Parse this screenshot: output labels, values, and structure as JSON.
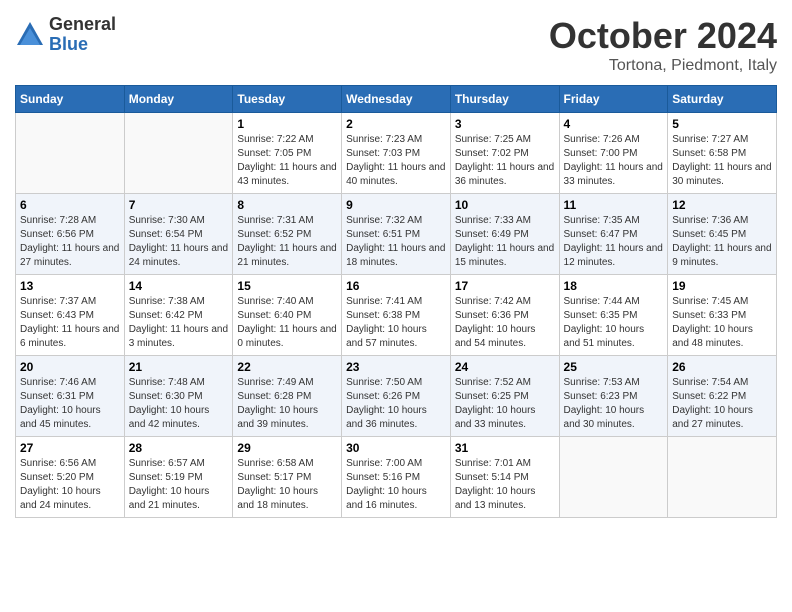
{
  "logo": {
    "general": "General",
    "blue": "Blue"
  },
  "title": {
    "month": "October 2024",
    "location": "Tortona, Piedmont, Italy"
  },
  "weekdays": [
    "Sunday",
    "Monday",
    "Tuesday",
    "Wednesday",
    "Thursday",
    "Friday",
    "Saturday"
  ],
  "weeks": [
    [
      {
        "day": "",
        "info": ""
      },
      {
        "day": "",
        "info": ""
      },
      {
        "day": "1",
        "info": "Sunrise: 7:22 AM\nSunset: 7:05 PM\nDaylight: 11 hours and 43 minutes."
      },
      {
        "day": "2",
        "info": "Sunrise: 7:23 AM\nSunset: 7:03 PM\nDaylight: 11 hours and 40 minutes."
      },
      {
        "day": "3",
        "info": "Sunrise: 7:25 AM\nSunset: 7:02 PM\nDaylight: 11 hours and 36 minutes."
      },
      {
        "day": "4",
        "info": "Sunrise: 7:26 AM\nSunset: 7:00 PM\nDaylight: 11 hours and 33 minutes."
      },
      {
        "day": "5",
        "info": "Sunrise: 7:27 AM\nSunset: 6:58 PM\nDaylight: 11 hours and 30 minutes."
      }
    ],
    [
      {
        "day": "6",
        "info": "Sunrise: 7:28 AM\nSunset: 6:56 PM\nDaylight: 11 hours and 27 minutes."
      },
      {
        "day": "7",
        "info": "Sunrise: 7:30 AM\nSunset: 6:54 PM\nDaylight: 11 hours and 24 minutes."
      },
      {
        "day": "8",
        "info": "Sunrise: 7:31 AM\nSunset: 6:52 PM\nDaylight: 11 hours and 21 minutes."
      },
      {
        "day": "9",
        "info": "Sunrise: 7:32 AM\nSunset: 6:51 PM\nDaylight: 11 hours and 18 minutes."
      },
      {
        "day": "10",
        "info": "Sunrise: 7:33 AM\nSunset: 6:49 PM\nDaylight: 11 hours and 15 minutes."
      },
      {
        "day": "11",
        "info": "Sunrise: 7:35 AM\nSunset: 6:47 PM\nDaylight: 11 hours and 12 minutes."
      },
      {
        "day": "12",
        "info": "Sunrise: 7:36 AM\nSunset: 6:45 PM\nDaylight: 11 hours and 9 minutes."
      }
    ],
    [
      {
        "day": "13",
        "info": "Sunrise: 7:37 AM\nSunset: 6:43 PM\nDaylight: 11 hours and 6 minutes."
      },
      {
        "day": "14",
        "info": "Sunrise: 7:38 AM\nSunset: 6:42 PM\nDaylight: 11 hours and 3 minutes."
      },
      {
        "day": "15",
        "info": "Sunrise: 7:40 AM\nSunset: 6:40 PM\nDaylight: 11 hours and 0 minutes."
      },
      {
        "day": "16",
        "info": "Sunrise: 7:41 AM\nSunset: 6:38 PM\nDaylight: 10 hours and 57 minutes."
      },
      {
        "day": "17",
        "info": "Sunrise: 7:42 AM\nSunset: 6:36 PM\nDaylight: 10 hours and 54 minutes."
      },
      {
        "day": "18",
        "info": "Sunrise: 7:44 AM\nSunset: 6:35 PM\nDaylight: 10 hours and 51 minutes."
      },
      {
        "day": "19",
        "info": "Sunrise: 7:45 AM\nSunset: 6:33 PM\nDaylight: 10 hours and 48 minutes."
      }
    ],
    [
      {
        "day": "20",
        "info": "Sunrise: 7:46 AM\nSunset: 6:31 PM\nDaylight: 10 hours and 45 minutes."
      },
      {
        "day": "21",
        "info": "Sunrise: 7:48 AM\nSunset: 6:30 PM\nDaylight: 10 hours and 42 minutes."
      },
      {
        "day": "22",
        "info": "Sunrise: 7:49 AM\nSunset: 6:28 PM\nDaylight: 10 hours and 39 minutes."
      },
      {
        "day": "23",
        "info": "Sunrise: 7:50 AM\nSunset: 6:26 PM\nDaylight: 10 hours and 36 minutes."
      },
      {
        "day": "24",
        "info": "Sunrise: 7:52 AM\nSunset: 6:25 PM\nDaylight: 10 hours and 33 minutes."
      },
      {
        "day": "25",
        "info": "Sunrise: 7:53 AM\nSunset: 6:23 PM\nDaylight: 10 hours and 30 minutes."
      },
      {
        "day": "26",
        "info": "Sunrise: 7:54 AM\nSunset: 6:22 PM\nDaylight: 10 hours and 27 minutes."
      }
    ],
    [
      {
        "day": "27",
        "info": "Sunrise: 6:56 AM\nSunset: 5:20 PM\nDaylight: 10 hours and 24 minutes."
      },
      {
        "day": "28",
        "info": "Sunrise: 6:57 AM\nSunset: 5:19 PM\nDaylight: 10 hours and 21 minutes."
      },
      {
        "day": "29",
        "info": "Sunrise: 6:58 AM\nSunset: 5:17 PM\nDaylight: 10 hours and 18 minutes."
      },
      {
        "day": "30",
        "info": "Sunrise: 7:00 AM\nSunset: 5:16 PM\nDaylight: 10 hours and 16 minutes."
      },
      {
        "day": "31",
        "info": "Sunrise: 7:01 AM\nSunset: 5:14 PM\nDaylight: 10 hours and 13 minutes."
      },
      {
        "day": "",
        "info": ""
      },
      {
        "day": "",
        "info": ""
      }
    ]
  ]
}
